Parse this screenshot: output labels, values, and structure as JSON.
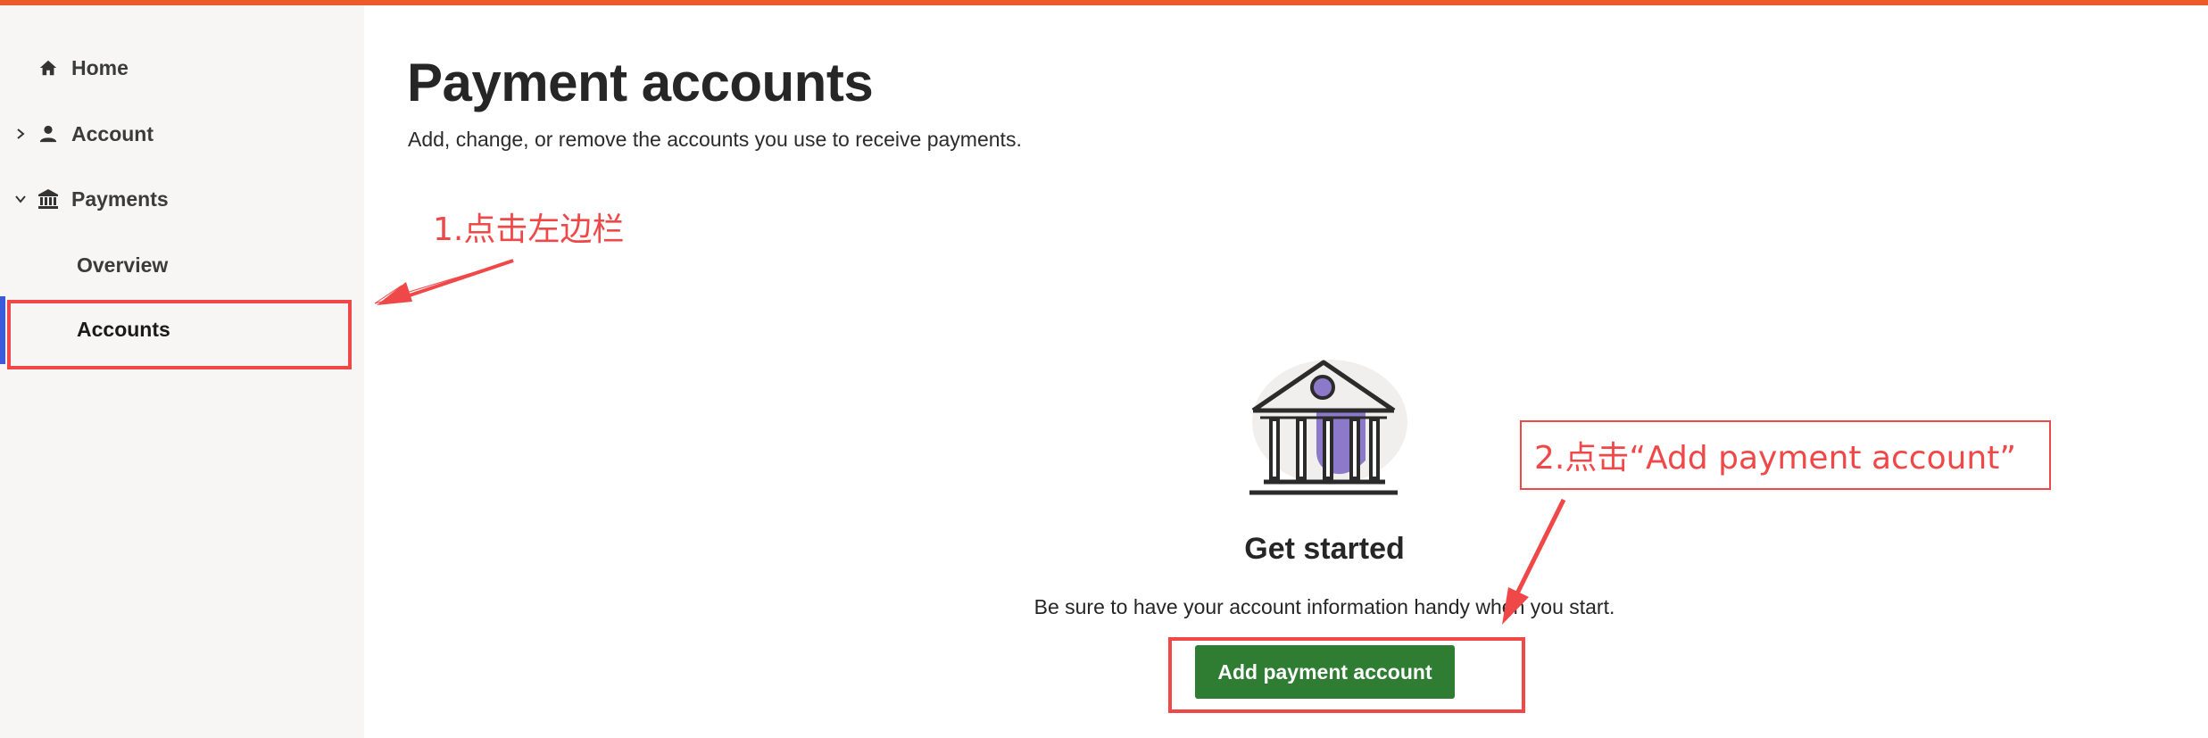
{
  "theme": {
    "brand_color": "#ee5b2a",
    "active_indicator": "#3b5bdb",
    "primary_button": "#2e7d32",
    "annotation_color": "#f04848",
    "illustration_accent": "#8d79c9"
  },
  "sidebar": {
    "items": [
      {
        "label": "Home",
        "icon": "home-icon"
      },
      {
        "label": "Account",
        "icon": "person-icon",
        "chevron": "chevron-right-icon"
      },
      {
        "label": "Payments",
        "icon": "bank-icon",
        "chevron": "chevron-down-icon"
      },
      {
        "label": "Overview"
      },
      {
        "label": "Accounts",
        "active": true
      }
    ]
  },
  "main": {
    "title": "Payment accounts",
    "subtitle": "Add, change, or remove the accounts you use to receive payments."
  },
  "empty_state": {
    "illustration": "bank-illustration",
    "title": "Get started",
    "text": "Be sure to have your account information handy when you start.",
    "button_label": "Add payment account"
  },
  "annotations": {
    "step1": "1.点击左边栏",
    "step2": "2.点击“Add payment account”"
  }
}
